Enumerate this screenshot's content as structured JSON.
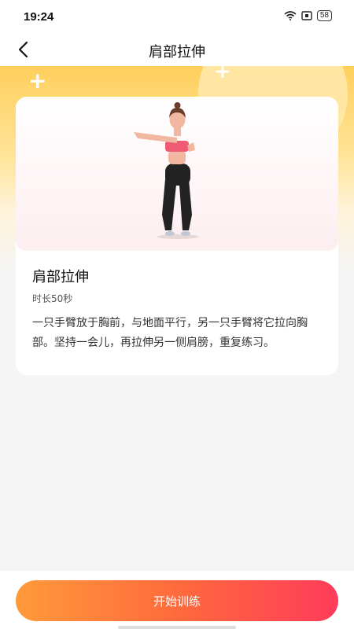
{
  "status_bar": {
    "time": "19:24",
    "battery": "58"
  },
  "header": {
    "title": "肩部拉伸"
  },
  "exercise": {
    "name": "肩部拉伸",
    "duration": "时长50秒",
    "description": "一只手臂放于胸前，与地面平行，另一只手臂将它拉向胸部。坚持一会儿，再拉伸另一侧肩膀，重复练习。"
  },
  "actions": {
    "start_label": "开始训练"
  },
  "colors": {
    "accent_start": "#ff9a3a",
    "accent_end": "#ff3b5a",
    "banner": "#ffcf5c"
  }
}
